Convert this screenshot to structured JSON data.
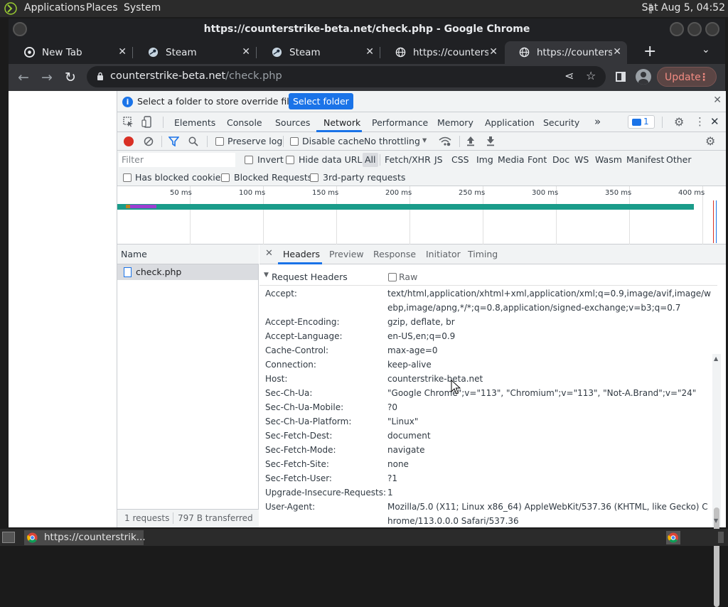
{
  "os": {
    "menus": [
      "Applications",
      "Places",
      "System"
    ],
    "clock": "Sat Aug  5, 04:52"
  },
  "window": {
    "title": "https://counterstrike-beta.net/check.php - Google Chrome"
  },
  "tabs": [
    {
      "label": "New Tab",
      "icon": "chrome-icon"
    },
    {
      "label": "Steam",
      "icon": "steam-icon"
    },
    {
      "label": "Steam",
      "icon": "steam-icon"
    },
    {
      "label": "https://counterstrike",
      "icon": "globe-icon"
    },
    {
      "label": "https://counterstrike",
      "icon": "globe-icon",
      "active": true
    }
  ],
  "omnibox": {
    "host": "counterstrike-beta.net",
    "path": "/check.php"
  },
  "toolbar": {
    "update_label": "Update"
  },
  "infobar": {
    "message": "Select a folder to store override files in.",
    "button": "Select folder"
  },
  "devtools": {
    "tabs": [
      "Elements",
      "Console",
      "Sources",
      "Network",
      "Performance",
      "Memory",
      "Application",
      "Security"
    ],
    "active_tab": "Network",
    "more": "»",
    "issues_count": "1",
    "network": {
      "preserve_log": "Preserve log",
      "disable_cache": "Disable cache",
      "throttling": "No throttling",
      "filter_placeholder": "Filter",
      "invert": "Invert",
      "hide_data_urls": "Hide data URLs",
      "types": [
        "All",
        "Fetch/XHR",
        "JS",
        "CSS",
        "Img",
        "Media",
        "Font",
        "Doc",
        "WS",
        "Wasm",
        "Manifest",
        "Other"
      ],
      "has_blocked_cookies": "Has blocked cookies",
      "blocked_requests": "Blocked Requests",
      "third_party": "3rd-party requests",
      "timeline_ticks": [
        "50 ms",
        "100 ms",
        "150 ms",
        "200 ms",
        "250 ms",
        "300 ms",
        "350 ms",
        "400 ms"
      ],
      "name_column": "Name",
      "request": "check.php",
      "status_requests": "1 requests",
      "status_transferred": "797 B transferred"
    },
    "detail_tabs": [
      "Headers",
      "Preview",
      "Response",
      "Initiator",
      "Timing"
    ],
    "request_headers_title": "Request Headers",
    "raw_label": "Raw",
    "headers": [
      {
        "name": "Accept:",
        "value": "text/html,application/xhtml+xml,application/xml;q=0.9,image/avif,image/webp,image/apng,*/*;q=0.8,application/signed-exchange;v=b3;q=0.7"
      },
      {
        "name": "Accept-Encoding:",
        "value": "gzip, deflate, br"
      },
      {
        "name": "Accept-Language:",
        "value": "en-US,en;q=0.9"
      },
      {
        "name": "Cache-Control:",
        "value": "max-age=0"
      },
      {
        "name": "Connection:",
        "value": "keep-alive"
      },
      {
        "name": "Host:",
        "value": "counterstrike-beta.net"
      },
      {
        "name": "Sec-Ch-Ua:",
        "value": "\"Google Chrome\";v=\"113\", \"Chromium\";v=\"113\", \"Not-A.Brand\";v=\"24\""
      },
      {
        "name": "Sec-Ch-Ua-Mobile:",
        "value": "?0"
      },
      {
        "name": "Sec-Ch-Ua-Platform:",
        "value": "\"Linux\""
      },
      {
        "name": "Sec-Fetch-Dest:",
        "value": "document"
      },
      {
        "name": "Sec-Fetch-Mode:",
        "value": "navigate"
      },
      {
        "name": "Sec-Fetch-Site:",
        "value": "none"
      },
      {
        "name": "Sec-Fetch-User:",
        "value": "?1"
      },
      {
        "name": "Upgrade-Insecure-Requests:",
        "value": "1"
      },
      {
        "name": "User-Agent:",
        "value": "Mozilla/5.0 (X11; Linux x86_64) AppleWebKit/537.36 (KHTML, like Gecko) Chrome/113.0.0.0 Safari/537.36"
      }
    ]
  },
  "taskbar": {
    "window_label": "https://counterstrik..."
  }
}
